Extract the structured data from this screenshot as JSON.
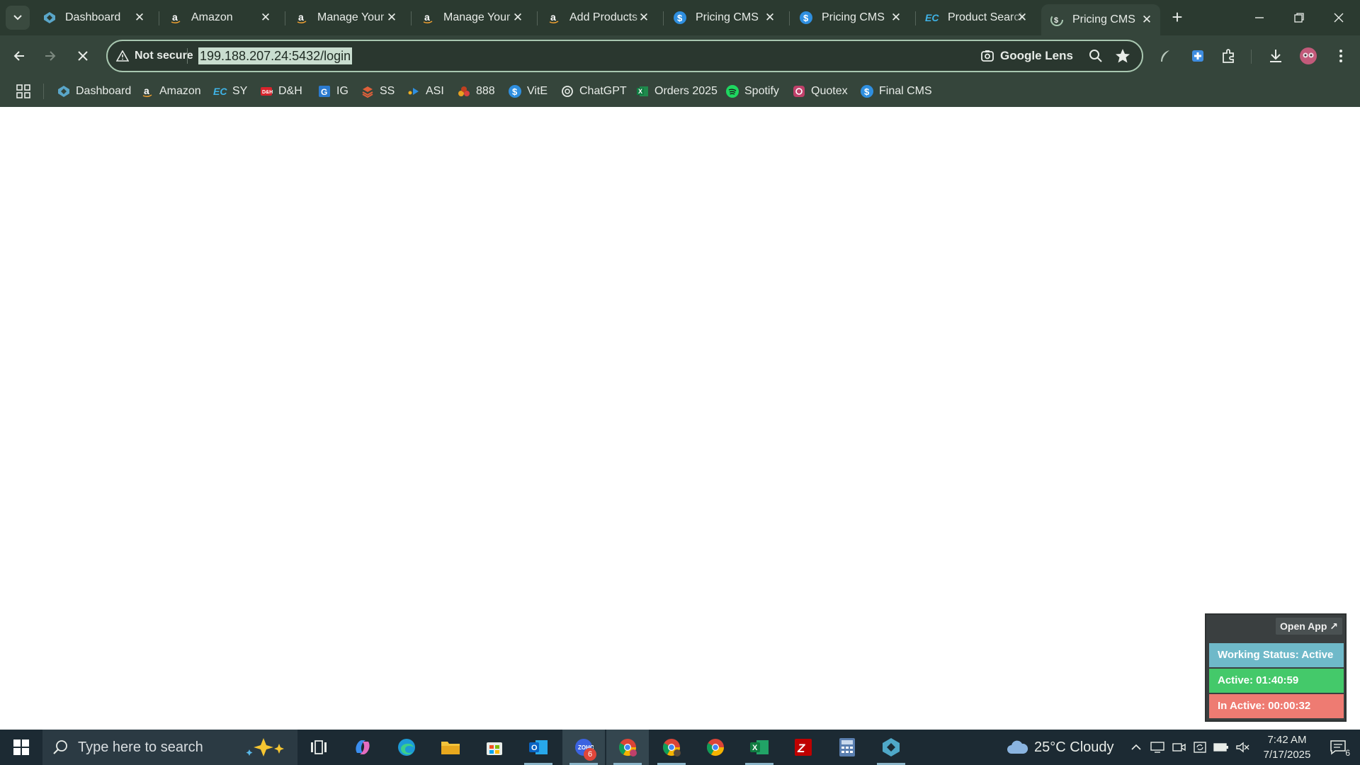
{
  "browser": {
    "tabs": [
      {
        "title": "Dashboard",
        "icon": "dashboard-logo-icon",
        "active": false
      },
      {
        "title": "Amazon",
        "icon": "amazon-icon",
        "active": false
      },
      {
        "title": "Manage Your",
        "icon": "amazon-icon",
        "active": false
      },
      {
        "title": "Manage Your",
        "icon": "amazon-icon",
        "active": false
      },
      {
        "title": "Add Products",
        "icon": "amazon-icon",
        "active": false
      },
      {
        "title": "Pricing CMS",
        "icon": "dollar-icon",
        "active": false
      },
      {
        "title": "Pricing CMS",
        "icon": "dollar-icon",
        "active": false
      },
      {
        "title": "Product Search",
        "icon": "ec-icon",
        "active": false
      },
      {
        "title": "Pricing CMS",
        "icon": "dollar-loading-icon",
        "active": true
      }
    ],
    "omnibox": {
      "security_label": "Not secure",
      "url": "199.188.207.24:5432/login",
      "lens_label": "Google Lens"
    },
    "bookmarks": [
      {
        "label": "Dashboard",
        "icon": "dashboard-logo-icon"
      },
      {
        "label": "Amazon",
        "icon": "amazon-icon"
      },
      {
        "label": "SY",
        "icon": "ec-icon"
      },
      {
        "label": "D&H",
        "icon": "dh-icon"
      },
      {
        "label": "IG",
        "icon": "ig-icon"
      },
      {
        "label": "SS",
        "icon": "ss-icon"
      },
      {
        "label": "ASI",
        "icon": "asi-icon"
      },
      {
        "label": "888",
        "icon": "888-icon"
      },
      {
        "label": "VitE",
        "icon": "dollar-icon"
      },
      {
        "label": "ChatGPT",
        "icon": "chatgpt-icon"
      },
      {
        "label": "Orders 2025",
        "icon": "excel-icon"
      },
      {
        "label": "Spotify",
        "icon": "spotify-icon"
      },
      {
        "label": "Quotex",
        "icon": "quotex-icon"
      },
      {
        "label": "Final CMS",
        "icon": "dollar-icon"
      }
    ]
  },
  "widget": {
    "open_app": "Open App ↗",
    "working_status": "Working Status: Active",
    "active_time": "Active: 01:40:59",
    "inactive_time": "In Active: 00:00:32",
    "colors": {
      "status": "#6fb9c9",
      "active": "#44c96a",
      "inactive": "#ee7b72"
    }
  },
  "taskbar": {
    "search_placeholder": "Type here to search",
    "weather": "25°C  Cloudy",
    "time": "7:42 AM",
    "date": "7/17/2025",
    "notification_count": "6",
    "zoho_badge": "6"
  }
}
